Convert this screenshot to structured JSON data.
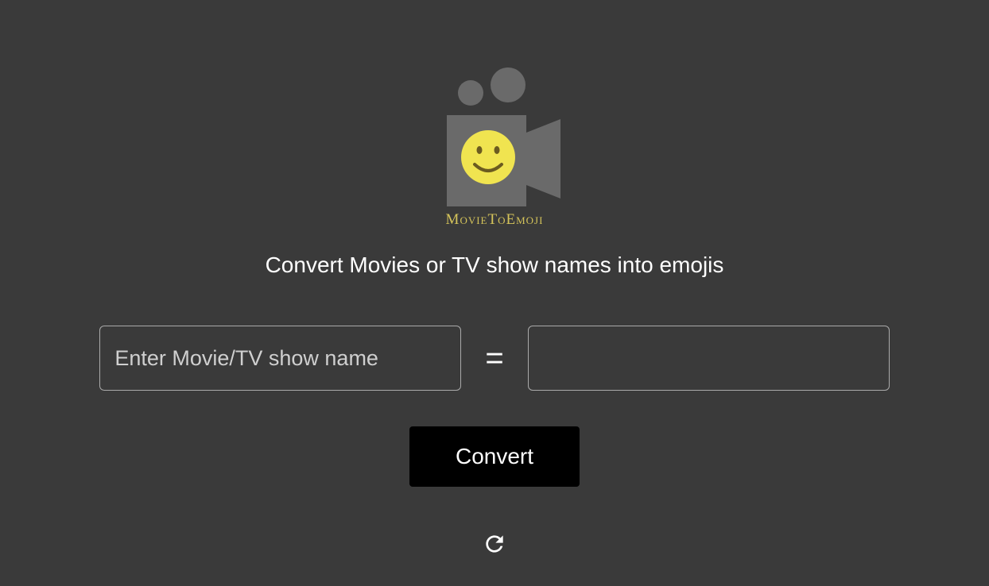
{
  "logo": {
    "text": "MovieToEmoji"
  },
  "subtitle": "Convert Movies or TV show names into emojis",
  "input": {
    "placeholder": "Enter Movie/TV show name",
    "value": ""
  },
  "equals": "=",
  "output": {
    "value": ""
  },
  "convert_button": "Convert"
}
